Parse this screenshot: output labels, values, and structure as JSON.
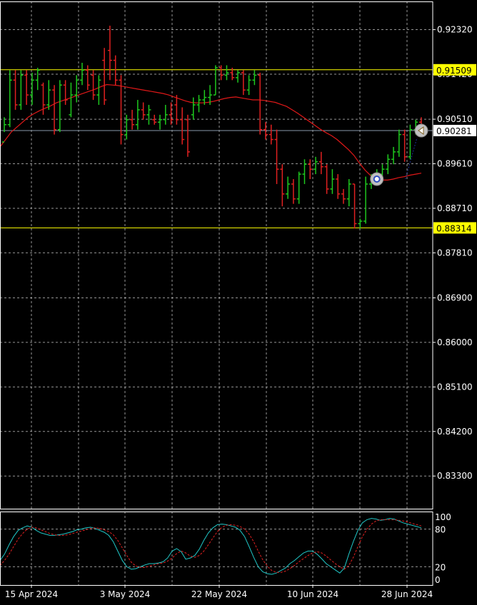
{
  "colors": {
    "background": "#000000",
    "grid": "#c8c8c8",
    "axis": "#ffffff",
    "bull": "#1ec81e",
    "bear": "#e02020",
    "ma": "#e01818",
    "level": "#ffff00",
    "current": "#8899aa",
    "stoch_main": "#20c8c8",
    "stoch_signal": "#e02020"
  },
  "chart_data": [
    {
      "type": "candlestick",
      "title": "",
      "ylim": [
        0.8264,
        0.9289
      ],
      "y_ticks": [
        "0.92320",
        "0.91420",
        "0.90510",
        "0.89610",
        "0.88710",
        "0.87810",
        "0.86900",
        "0.86000",
        "0.85100",
        "0.84200",
        "0.83300"
      ],
      "x_labels": [
        "15 Apr 2024",
        "3 May 2024",
        "22 May 2024",
        "10 Jun 2024",
        "28 Jun 2024"
      ],
      "levels": [
        {
          "label": "0.91509",
          "value": 0.91509
        },
        {
          "label": "0.88314",
          "value": 0.88314
        }
      ],
      "current_price": {
        "label": "0.90281",
        "value": 0.90281
      },
      "bars": [
        [
          0.9005,
          0.9055,
          0.9025,
          0.904
        ],
        [
          0.904,
          0.915,
          0.9035,
          0.913
        ],
        [
          0.913,
          0.915,
          0.907,
          0.908
        ],
        [
          0.908,
          0.915,
          0.907,
          0.914
        ],
        [
          0.914,
          0.915,
          0.908,
          0.91
        ],
        [
          0.91,
          0.9145,
          0.908,
          0.913
        ],
        [
          0.913,
          0.9155,
          0.911,
          0.915
        ],
        [
          0.912,
          0.9125,
          0.906,
          0.908
        ],
        [
          0.908,
          0.913,
          0.907,
          0.911
        ],
        [
          0.911,
          0.912,
          0.902,
          0.903
        ],
        [
          0.903,
          0.913,
          0.9025,
          0.912
        ],
        [
          0.912,
          0.913,
          0.908,
          0.909
        ],
        [
          0.906,
          0.9125,
          0.9055,
          0.91
        ],
        [
          0.91,
          0.914,
          0.9085,
          0.913
        ],
        [
          0.913,
          0.9165,
          0.912,
          0.915
        ],
        [
          0.915,
          0.916,
          0.911,
          0.912
        ],
        [
          0.914,
          0.915,
          0.909,
          0.91
        ],
        [
          0.91,
          0.914,
          0.908,
          0.913
        ],
        [
          0.917,
          0.9195,
          0.908,
          0.909
        ],
        [
          0.919,
          0.924,
          0.913,
          0.917
        ],
        [
          0.917,
          0.918,
          0.912,
          0.913
        ],
        [
          0.913,
          0.914,
          0.9,
          0.902
        ],
        [
          0.902,
          0.906,
          0.901,
          0.905
        ],
        [
          0.905,
          0.907,
          0.903,
          0.904
        ],
        [
          0.904,
          0.909,
          0.903,
          0.907
        ],
        [
          0.907,
          0.9085,
          0.905,
          0.906
        ],
        [
          0.906,
          0.908,
          0.904,
          0.907
        ],
        [
          0.905,
          0.906,
          0.904,
          0.9045
        ],
        [
          0.9045,
          0.906,
          0.903,
          0.905
        ],
        [
          0.905,
          0.908,
          0.904,
          0.906
        ],
        [
          0.906,
          0.9085,
          0.904,
          0.905
        ],
        [
          0.908,
          0.91,
          0.904,
          0.905
        ],
        [
          0.905,
          0.9075,
          0.9,
          0.901
        ],
        [
          0.905,
          0.906,
          0.8975,
          0.8985
        ],
        [
          0.906,
          0.9095,
          0.905,
          0.908
        ],
        [
          0.908,
          0.91,
          0.9065,
          0.909
        ],
        [
          0.909,
          0.911,
          0.908,
          0.9095
        ],
        [
          0.9095,
          0.912,
          0.908,
          0.91
        ],
        [
          0.91,
          0.916,
          0.91,
          0.9155
        ],
        [
          0.9155,
          0.916,
          0.913,
          0.914
        ],
        [
          0.914,
          0.916,
          0.913,
          0.9145
        ],
        [
          0.9145,
          0.9155,
          0.913,
          0.9135
        ],
        [
          0.9135,
          0.915,
          0.9125,
          0.9145
        ],
        [
          0.9145,
          0.915,
          0.91,
          0.911
        ],
        [
          0.911,
          0.914,
          0.91,
          0.913
        ],
        [
          0.913,
          0.915,
          0.912,
          0.914
        ],
        [
          0.914,
          0.9145,
          0.902,
          0.903
        ],
        [
          0.903,
          0.9045,
          0.901,
          0.902
        ],
        [
          0.902,
          0.904,
          0.9,
          0.901
        ],
        [
          0.901,
          0.903,
          0.892,
          0.895
        ],
        [
          0.895,
          0.896,
          0.8875,
          0.89
        ],
        [
          0.89,
          0.8935,
          0.889,
          0.892
        ],
        [
          0.892,
          0.893,
          0.888,
          0.889
        ],
        [
          0.889,
          0.8945,
          0.888,
          0.894
        ],
        [
          0.894,
          0.897,
          0.892,
          0.896
        ],
        [
          0.896,
          0.897,
          0.893,
          0.895
        ],
        [
          0.895,
          0.8975,
          0.894,
          0.8965
        ],
        [
          0.8965,
          0.8985,
          0.894,
          0.8955
        ],
        [
          0.8955,
          0.896,
          0.89,
          0.891
        ],
        [
          0.891,
          0.895,
          0.89,
          0.893
        ],
        [
          0.893,
          0.894,
          0.889,
          0.89
        ],
        [
          0.89,
          0.891,
          0.888,
          0.889
        ],
        [
          0.889,
          0.893,
          0.8875,
          0.892
        ],
        [
          0.892,
          0.892,
          0.883,
          0.884
        ],
        [
          0.884,
          0.885,
          0.883,
          0.8845
        ],
        [
          0.8845,
          0.8935,
          0.884,
          0.892
        ],
        [
          0.892,
          0.894,
          0.891,
          0.893
        ],
        [
          0.893,
          0.895,
          0.892,
          0.894
        ],
        [
          0.894,
          0.896,
          0.8925,
          0.895
        ],
        [
          0.895,
          0.898,
          0.894,
          0.897
        ],
        [
          0.897,
          0.8995,
          0.896,
          0.8985
        ],
        [
          0.8985,
          0.903,
          0.8975,
          0.902
        ],
        [
          0.902,
          0.903,
          0.8965,
          0.8975
        ],
        [
          0.8975,
          0.904,
          0.897,
          0.903
        ],
        [
          0.903,
          0.905,
          0.902,
          0.9045
        ],
        [
          0.9045,
          0.9055,
          0.903,
          0.904
        ]
      ],
      "moving_average": [
        0.8995,
        0.901,
        0.9025,
        0.9035,
        0.9045,
        0.9055,
        0.9062,
        0.9068,
        0.9073,
        0.9078,
        0.9084,
        0.9088,
        0.9092,
        0.9096,
        0.91,
        0.9104,
        0.9108,
        0.9112,
        0.9117,
        0.9121,
        0.912,
        0.9119,
        0.9117,
        0.9115,
        0.9113,
        0.9111,
        0.9109,
        0.9107,
        0.9105,
        0.9103,
        0.91,
        0.9096,
        0.9092,
        0.9088,
        0.9085,
        0.9084,
        0.9084,
        0.9085,
        0.9087,
        0.909,
        0.9093,
        0.9095,
        0.9096,
        0.9094,
        0.9092,
        0.909,
        0.909,
        0.9089,
        0.9087,
        0.9085,
        0.9081,
        0.9077,
        0.907,
        0.9063,
        0.9055,
        0.9047,
        0.9039,
        0.9031,
        0.9024,
        0.9018,
        0.901,
        0.9,
        0.899,
        0.8978,
        0.8962,
        0.8948,
        0.8937,
        0.8931,
        0.8928,
        0.8928,
        0.893,
        0.8933,
        0.8935,
        0.8938,
        0.894,
        0.8942
      ],
      "signal_markers": [
        {
          "bar": 67,
          "value": 0.893
        },
        {
          "bar": 75,
          "value": 0.9028
        }
      ]
    },
    {
      "type": "line",
      "title": "",
      "ylim": [
        0,
        100
      ],
      "y_ticks": [
        "100",
        "80",
        "20",
        "0"
      ],
      "series": [
        {
          "role": "main",
          "values": [
            30,
            40,
            55,
            68,
            78,
            82,
            85,
            83,
            78,
            74,
            72,
            70,
            70,
            71,
            72,
            74,
            76,
            79,
            80,
            82,
            83,
            81,
            78,
            75,
            70,
            60,
            45,
            30,
            20,
            16,
            17,
            20,
            23,
            25,
            25,
            26,
            28,
            34,
            45,
            49,
            44,
            32,
            34,
            38,
            48,
            62,
            74,
            82,
            87,
            88,
            87,
            85,
            83,
            78,
            68,
            52,
            35,
            20,
            12,
            9,
            8,
            10,
            14,
            18,
            25,
            30,
            36,
            42,
            45,
            45,
            40,
            33,
            25,
            20,
            15,
            10,
            18,
            40,
            60,
            78,
            90,
            95,
            97,
            96,
            94,
            95,
            97,
            96,
            93,
            90,
            88,
            86,
            84,
            82
          ]
        },
        {
          "role": "signal",
          "values": [
            22,
            30,
            40,
            52,
            64,
            73,
            80,
            83,
            82,
            79,
            76,
            73,
            71,
            70,
            70,
            71,
            73,
            75,
            77,
            79,
            81,
            82,
            81,
            79,
            76,
            71,
            62,
            50,
            38,
            27,
            21,
            19,
            19,
            21,
            23,
            25,
            26,
            29,
            34,
            41,
            45,
            42,
            37,
            35,
            38,
            45,
            55,
            66,
            76,
            83,
            86,
            87,
            86,
            84,
            80,
            72,
            60,
            45,
            31,
            21,
            14,
            11,
            11,
            13,
            17,
            22,
            28,
            33,
            38,
            42,
            44,
            42,
            37,
            31,
            25,
            20,
            16,
            22,
            35,
            52,
            68,
            80,
            88,
            93,
            95,
            95,
            95,
            95,
            94,
            93,
            91,
            89,
            87,
            85
          ]
        }
      ]
    }
  ]
}
